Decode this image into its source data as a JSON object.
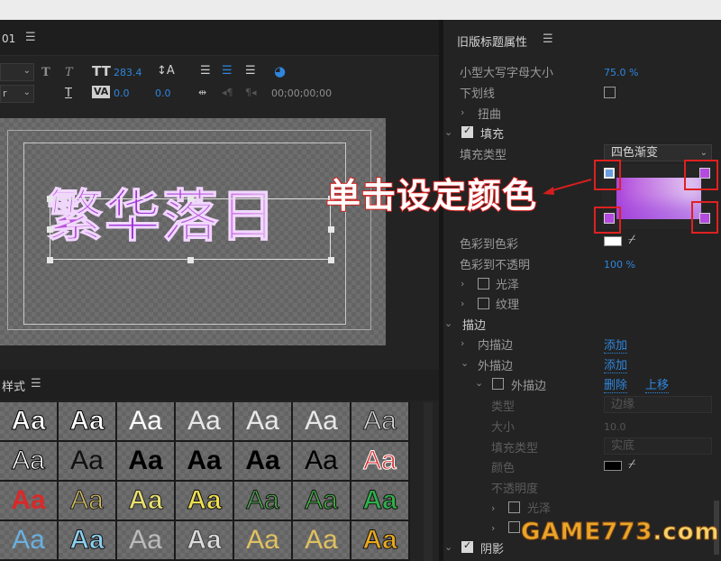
{
  "left_panel": {
    "tab_label": "01",
    "toolbar": {
      "kerning": "283.4",
      "leading": "0.0",
      "baseline": "0.0",
      "timecode": "00;00;00;00"
    },
    "stage_text": "繁华落日"
  },
  "styles_panel": {
    "tab_label": "样式",
    "swatch_text": "Aa",
    "cells": [
      {
        "color": "#ffffff",
        "bg": "#555555",
        "stroke": "#000000",
        "weight": "bold"
      },
      {
        "color": "#ffffff",
        "bg": "#555555",
        "stroke": "#000000",
        "weight": "bold"
      },
      {
        "color": "#ffffff",
        "bg": "#222222",
        "stroke": "",
        "weight": "normal"
      },
      {
        "color": "#e8e8e8",
        "bg": "#555555",
        "stroke": "",
        "weight": "normal"
      },
      {
        "color": "#e8e8e8",
        "bg": "#555555",
        "stroke": "",
        "weight": "normal"
      },
      {
        "color": "#e8e8e8",
        "bg": "#555555",
        "stroke": "",
        "weight": "normal"
      },
      {
        "color": "#dddddd",
        "bg": "#555555",
        "stroke": "#222222",
        "weight": "normal"
      },
      {
        "color": "#ffffff",
        "bg": "#555555",
        "stroke": "#000000",
        "weight": "normal"
      },
      {
        "color": "#111111",
        "bg": "#707070",
        "stroke": "",
        "weight": "normal"
      },
      {
        "color": "#000000",
        "bg": "#707070",
        "stroke": "",
        "weight": "bold"
      },
      {
        "color": "#000000",
        "bg": "#707070",
        "stroke": "",
        "weight": "bold"
      },
      {
        "color": "#000000",
        "bg": "#707070",
        "stroke": "",
        "weight": "bold"
      },
      {
        "color": "#000000",
        "bg": "#707070",
        "stroke": "",
        "weight": "normal"
      },
      {
        "color": "#d73030",
        "bg": "#707070",
        "stroke": "#ffffff",
        "weight": "normal"
      },
      {
        "color": "#d82a2a",
        "bg": "#555555",
        "stroke": "",
        "weight": "bold"
      },
      {
        "color": "#d8c060",
        "bg": "#555555",
        "stroke": "#222222",
        "weight": "normal"
      },
      {
        "color": "#e8e070",
        "bg": "#555555",
        "stroke": "#222222",
        "weight": "bold"
      },
      {
        "color": "#f0e050",
        "bg": "#555555",
        "stroke": "#111111",
        "weight": "bold"
      },
      {
        "color": "#4fa64f",
        "bg": "#555555",
        "stroke": "#111111",
        "weight": "normal"
      },
      {
        "color": "#45b045",
        "bg": "#555555",
        "stroke": "#111111",
        "weight": "normal"
      },
      {
        "color": "#2fb04a",
        "bg": "#555555",
        "stroke": "#111111",
        "weight": "bold"
      },
      {
        "color": "#6ab0e0",
        "bg": "#555555",
        "stroke": "",
        "weight": "normal"
      },
      {
        "color": "#8ed0f0",
        "bg": "#555555",
        "stroke": "#111111",
        "weight": "bold"
      },
      {
        "color": "#bbbbbb",
        "bg": "#555555",
        "stroke": "",
        "weight": "normal"
      },
      {
        "color": "#dddddd",
        "bg": "#555555",
        "stroke": "#444444",
        "weight": "bold"
      },
      {
        "color": "#e0c060",
        "bg": "#555555",
        "stroke": "",
        "weight": "normal"
      },
      {
        "color": "#e0c060",
        "bg": "#555555",
        "stroke": "",
        "weight": "normal"
      },
      {
        "color": "#e8a820",
        "bg": "#555555",
        "stroke": "#111111",
        "weight": "bold"
      }
    ]
  },
  "properties": {
    "title": "旧版标题属性",
    "rows": {
      "small_caps_size": "小型大写字母大小",
      "small_caps_value": "75.0 %",
      "underline": "下划线",
      "distort": "扭曲",
      "fill": "填充",
      "fill_type": "填充类型",
      "fill_type_value": "四色渐变",
      "color_to_color": "色彩到色彩",
      "color_to_opacity": "色彩到不透明",
      "opacity_value": "100 %",
      "sheen": "光泽",
      "texture": "纹理",
      "stroke": "描边",
      "inner_stroke": "内描边",
      "outer_stroke": "外描边",
      "outer_stroke_item": "外描边",
      "add": "添加",
      "add2": "添加",
      "delete": "删除",
      "move_up": "上移",
      "type": "类型",
      "type_value": "边缘",
      "size": "大小",
      "size_value": "10.0",
      "fill_type2": "填充类型",
      "fill_type2_value": "实底",
      "color": "颜色",
      "opacity": "不透明度",
      "sheen2": "光泽",
      "shadow": "阴影"
    },
    "gradient_colors": [
      "#b24bdc",
      "#e8d6f4"
    ]
  },
  "annotation": {
    "callout": "单击设定颜色"
  },
  "watermark": {
    "text": "GAME773",
    "suffix": ".com"
  }
}
